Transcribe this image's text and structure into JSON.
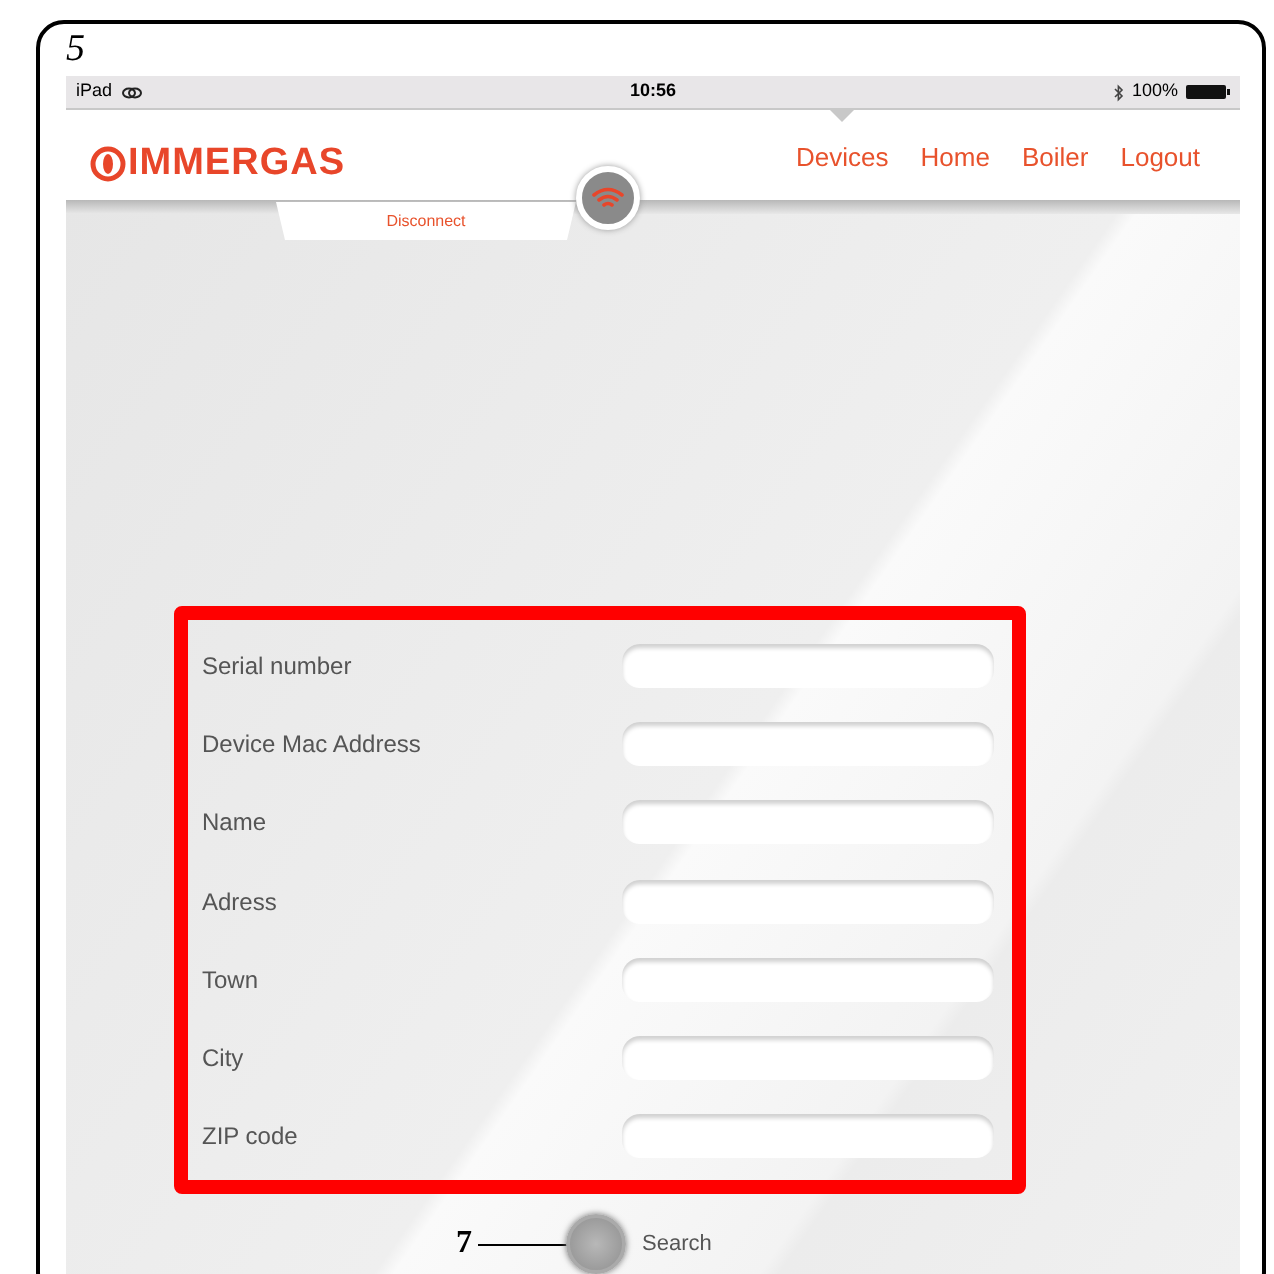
{
  "figure_number": "5",
  "status_bar": {
    "device": "iPad",
    "time": "10:56",
    "battery": "100%"
  },
  "header": {
    "logo": "IMMERGAS",
    "nav": [
      {
        "label": "Devices",
        "selected": true
      },
      {
        "label": "Home",
        "selected": false
      },
      {
        "label": "Boiler",
        "selected": false
      },
      {
        "label": "Logout",
        "selected": false
      }
    ]
  },
  "disconnect_button": "Disconnect",
  "form": {
    "fields": [
      {
        "label": "Serial number"
      },
      {
        "label": "Device Mac Address"
      },
      {
        "label": "Name"
      },
      {
        "label": "Adress"
      },
      {
        "label": "Town"
      },
      {
        "label": "City"
      },
      {
        "label": "ZIP code"
      }
    ]
  },
  "search_button": "Search",
  "callout": "7"
}
